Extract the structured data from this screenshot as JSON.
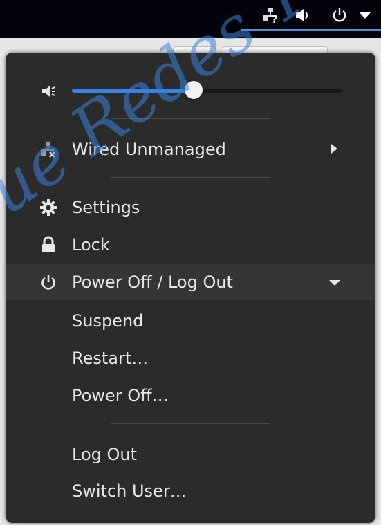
{
  "volume": {
    "level": 0.45,
    "icon": "speaker-icon"
  },
  "network": {
    "label": "Wired Unmanaged",
    "icon": "network-wired-disconnected-icon"
  },
  "settings": {
    "label": "Settings",
    "icon": "gear-icon"
  },
  "lock": {
    "label": "Lock",
    "icon": "lock-icon"
  },
  "power": {
    "label": "Power Off / Log Out",
    "icon": "power-icon",
    "items": [
      {
        "label": "Suspend"
      },
      {
        "label": "Restart…"
      },
      {
        "label": "Power Off…"
      }
    ],
    "session_items": [
      {
        "label": "Log Out"
      },
      {
        "label": "Switch User…"
      }
    ]
  },
  "colors": {
    "accent": "#3584e4",
    "menu_bg": "#2b2b2b",
    "topbar_bg": "#02030a"
  },
  "watermark": {
    "text": "ue Redes Y Se"
  }
}
